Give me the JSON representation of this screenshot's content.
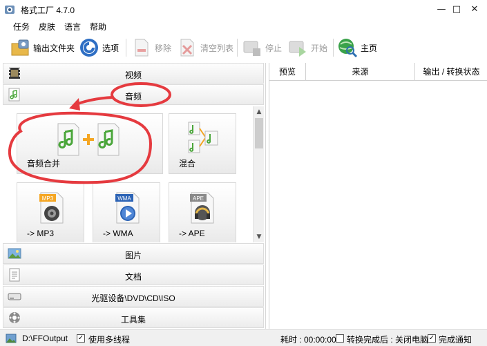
{
  "window": {
    "title": "格式工厂 4.7.0",
    "minimize": "—",
    "maximize": "□",
    "close": "✕"
  },
  "menu": [
    "任务",
    "皮肤",
    "语言",
    "帮助"
  ],
  "toolbar": {
    "output_folder": "输出文件夹",
    "options": "选项",
    "remove": "移除",
    "clear_list": "清空列表",
    "stop": "停止",
    "start": "开始",
    "home": "主页"
  },
  "categories": {
    "video": "视频",
    "audio": "音频",
    "picture": "图片",
    "document": "文档",
    "rom": "光驱设备\\DVD\\CD\\ISO",
    "tools": "工具集"
  },
  "audio_tiles": {
    "merge": "音频合并",
    "mix": "混合",
    "mp3": "-> MP3",
    "wma": "-> WMA",
    "ape": "-> APE",
    "mp3_badge": "MP3",
    "wma_badge": "WMA",
    "ape_badge": "APE"
  },
  "task_list": {
    "col_preview": "预览",
    "col_source": "来源",
    "col_status": "输出 / 转换状态"
  },
  "statusbar": {
    "output_path": "D:\\FFOutput",
    "multithread": "使用多线程",
    "elapsed": "耗时 : 00:00:00",
    "after_convert": "转换完成后 : 关闭电脑",
    "notify": "完成通知",
    "check": "✓"
  },
  "colors": {
    "annotation": "#e53a3f",
    "note_green": "#58b53a",
    "plus_orange": "#f5a623"
  }
}
